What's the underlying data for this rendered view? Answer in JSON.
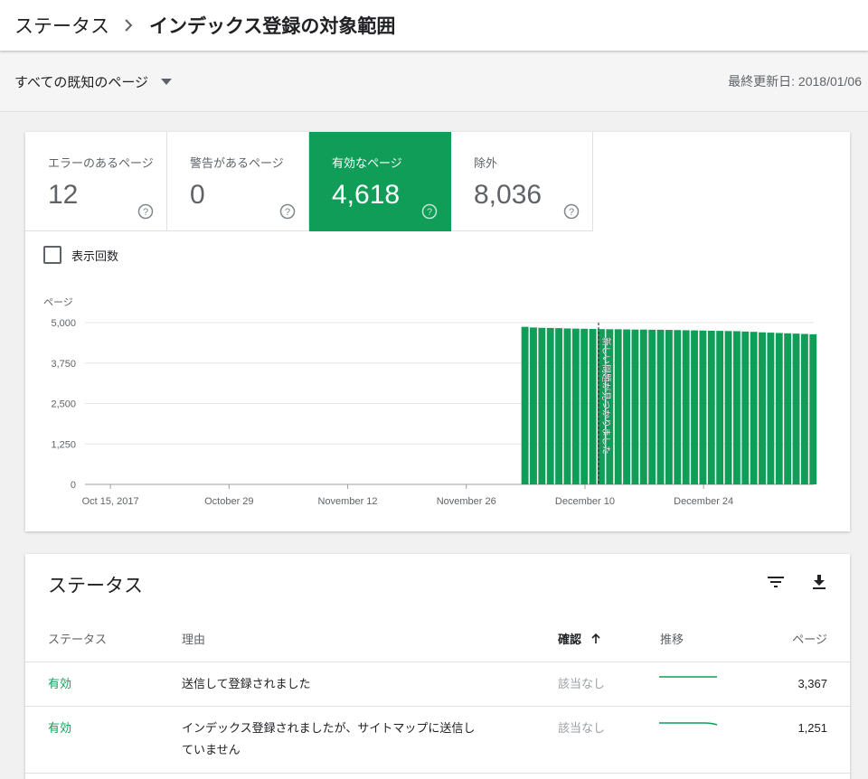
{
  "breadcrumb": {
    "root": "ステータス",
    "current": "インデックス登録の対象範囲"
  },
  "filter": {
    "label": "すべての既知のページ"
  },
  "last_updated": "最終更新日: 2018/01/06",
  "tiles": [
    {
      "label": "エラーのあるページ",
      "value": "12",
      "active": false
    },
    {
      "label": "警告があるページ",
      "value": "0",
      "active": false
    },
    {
      "label": "有効なページ",
      "value": "4,618",
      "active": true
    },
    {
      "label": "除外",
      "value": "8,036",
      "active": false
    }
  ],
  "impressions_label": "表示回数",
  "colors": {
    "accent": "#0f9d58",
    "grid": "#e6e6e6",
    "text_muted": "#5f6368"
  },
  "chart_data": {
    "type": "bar",
    "ylabel": "ページ",
    "ylim": [
      0,
      5000
    ],
    "yticks": [
      "5,000",
      "3,750",
      "2,500",
      "1,250",
      "0"
    ],
    "yticks_values": [
      5000,
      3750,
      2500,
      1250,
      0
    ],
    "x_tick_labels": [
      "Oct 15, 2017",
      "October 29",
      "November 12",
      "November 26",
      "December 10",
      "December 24"
    ],
    "x_tick_positions": [
      "2017-10-15",
      "2017-10-29",
      "2017-11-12",
      "2017-11-26",
      "2017-12-10",
      "2017-12-24"
    ],
    "x_start": "2017-10-12",
    "x_end": "2018-01-06",
    "dates": [
      "2017-12-03",
      "2017-12-04",
      "2017-12-05",
      "2017-12-06",
      "2017-12-07",
      "2017-12-08",
      "2017-12-09",
      "2017-12-10",
      "2017-12-11",
      "2017-12-12",
      "2017-12-13",
      "2017-12-14",
      "2017-12-15",
      "2017-12-16",
      "2017-12-17",
      "2017-12-18",
      "2017-12-19",
      "2017-12-20",
      "2017-12-21",
      "2017-12-22",
      "2017-12-23",
      "2017-12-24",
      "2017-12-25",
      "2017-12-26",
      "2017-12-27",
      "2017-12-28",
      "2017-12-29",
      "2017-12-30",
      "2017-12-31",
      "2018-01-01",
      "2018-01-02",
      "2018-01-03",
      "2018-01-04",
      "2018-01-05",
      "2018-01-06"
    ],
    "values": [
      4870,
      4850,
      4840,
      4835,
      4830,
      4820,
      4815,
      4810,
      4805,
      4800,
      4795,
      4795,
      4790,
      4785,
      4785,
      4780,
      4780,
      4775,
      4770,
      4765,
      4760,
      4755,
      4750,
      4745,
      4740,
      4735,
      4725,
      4715,
      4700,
      4690,
      4680,
      4670,
      4660,
      4650,
      4640
    ],
    "annotation": {
      "date": "2017-12-12",
      "text": "新しい問題が見つかりました"
    }
  },
  "table": {
    "title": "ステータス",
    "headers": {
      "status": "ステータス",
      "reason": "理由",
      "validation": "確認",
      "trend": "推移",
      "pages": "ページ"
    },
    "rows": [
      {
        "status": "有効",
        "reason_lines": [
          "送信して登録されました"
        ],
        "validation": "該当なし",
        "pages": "3,367"
      },
      {
        "status": "有効",
        "reason_lines": [
          "インデックス登録されましたが、サイトマップに送信し",
          "ていません"
        ],
        "validation": "該当なし",
        "pages": "1,251"
      }
    ]
  }
}
